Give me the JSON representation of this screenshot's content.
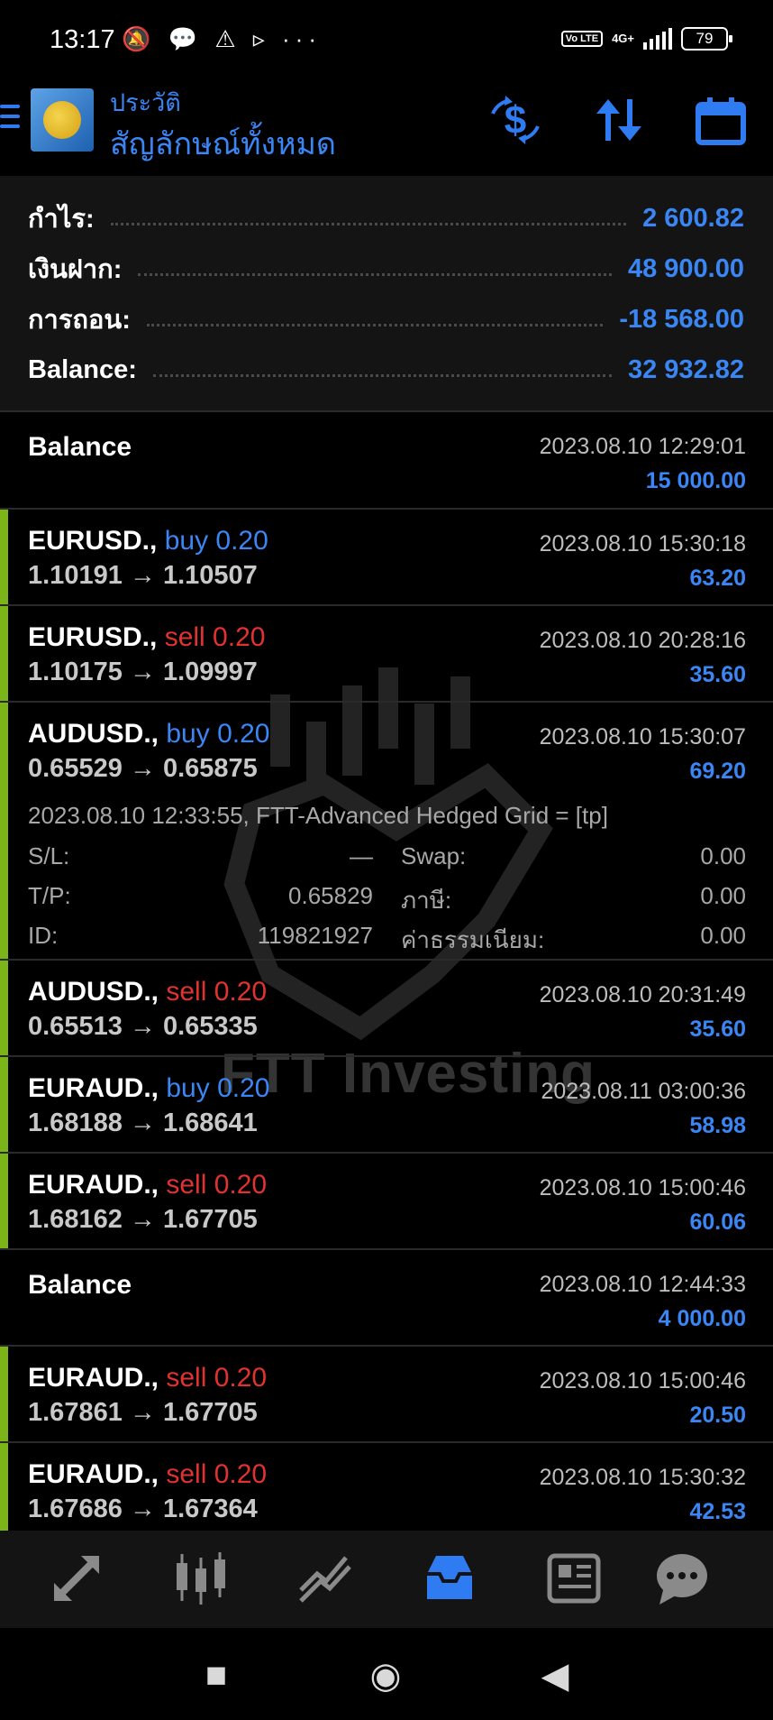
{
  "status_bar": {
    "time": "13:17",
    "icons": "🔕 💬 ⚠ ▹ ···",
    "volte": "Vo LTE",
    "network": "4G+",
    "battery": "79"
  },
  "header": {
    "subtitle": "ประวัติ",
    "title": "สัญลักษณ์ทั้งหมด",
    "btn_currency_icon": "dollar-swap-icon",
    "btn_sort_icon": "sort-icon",
    "btn_calendar_icon": "calendar-icon"
  },
  "summary": [
    {
      "label": "กำไร:",
      "value": "2 600.82"
    },
    {
      "label": "เงินฝาก:",
      "value": "48 900.00"
    },
    {
      "label": "การถอน:",
      "value": "-18 568.00"
    },
    {
      "label": "Balance:",
      "value": "32 932.82"
    }
  ],
  "rows": [
    {
      "type": "balance",
      "label": "Balance",
      "time": "2023.08.10 12:29:01",
      "amount": "15 000.00"
    },
    {
      "type": "trade",
      "symbol": "EURUSD.,",
      "direction": "buy 0.20",
      "prices": "1.10191 → 1.10507",
      "time": "2023.08.10 15:30:18",
      "profit": "63.20"
    },
    {
      "type": "trade",
      "symbol": "EURUSD.,",
      "direction": "sell 0.20",
      "prices": "1.10175 → 1.09997",
      "time": "2023.08.10 20:28:16",
      "profit": "35.60"
    },
    {
      "type": "trade",
      "symbol": "AUDUSD.,",
      "direction": "buy 0.20",
      "prices": "0.65529 → 0.65875",
      "time": "2023.08.10 15:30:07",
      "profit": "69.20"
    },
    {
      "type": "trade",
      "symbol": "AUDUSD.,",
      "direction": "sell 0.20",
      "prices": "0.65513 → 0.65335",
      "time": "2023.08.10 20:31:49",
      "profit": "35.60"
    },
    {
      "type": "trade",
      "symbol": "EURAUD.,",
      "direction": "buy 0.20",
      "prices": "1.68188 → 1.68641",
      "time": "2023.08.11 03:00:36",
      "profit": "58.98"
    },
    {
      "type": "trade",
      "symbol": "EURAUD.,",
      "direction": "sell 0.20",
      "prices": "1.68162 → 1.67705",
      "time": "2023.08.10 15:00:46",
      "profit": "60.06"
    },
    {
      "type": "balance",
      "label": "Balance",
      "time": "2023.08.10 12:44:33",
      "amount": "4 000.00"
    },
    {
      "type": "trade",
      "symbol": "EURAUD.,",
      "direction": "sell 0.20",
      "prices": "1.67861 → 1.67705",
      "time": "2023.08.10 15:00:46",
      "profit": "20.50"
    },
    {
      "type": "trade",
      "symbol": "EURAUD.,",
      "direction": "sell 0.20",
      "prices": "1.67686 → 1.67364",
      "time": "2023.08.10 15:30:32",
      "profit": "42.53"
    }
  ],
  "expanded_detail": {
    "comment": "2023.08.10 12:33:55, FTT-Advanced Hedged Grid = [tp]",
    "sl_label": "S/L:",
    "sl_value": "—",
    "swap_label": "Swap:",
    "swap_value": "0.00",
    "tp_label": "T/P:",
    "tp_value": "0.65829",
    "tax_label": "ภาษี:",
    "tax_value": "0.00",
    "id_label": "ID:",
    "id_value": "119821927",
    "fee_label": "ค่าธรรมเนียม:",
    "fee_value": "0.00"
  },
  "watermark": "FTT Investing",
  "bottom_nav": [
    {
      "name": "quotes-icon",
      "glyph": "⇄"
    },
    {
      "name": "chart-icon",
      "glyph": "▮▮▮"
    },
    {
      "name": "trade-icon",
      "glyph": "⟋"
    },
    {
      "name": "history-icon",
      "glyph": "▣",
      "active": true
    },
    {
      "name": "news-icon",
      "glyph": "▤"
    },
    {
      "name": "messages-icon",
      "glyph": "💬"
    }
  ],
  "system_nav": {
    "recent": "■",
    "home": "◉",
    "back": "◀"
  },
  "colors": {
    "accent": "#2f7bf2",
    "buy": "#3a86f5",
    "sell": "#e2322f",
    "trade_bar": "#7cb518"
  }
}
